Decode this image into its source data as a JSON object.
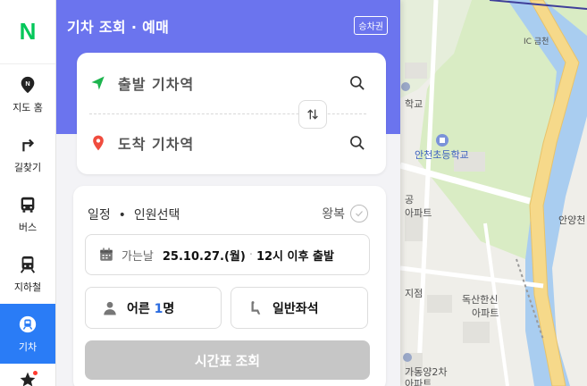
{
  "nav": {
    "logo": "N",
    "items": [
      {
        "label": "지도 홈",
        "icon": "map-pin-icon"
      },
      {
        "label": "길찾기",
        "icon": "directions-icon"
      },
      {
        "label": "버스",
        "icon": "bus-icon"
      },
      {
        "label": "지하철",
        "icon": "subway-icon"
      },
      {
        "label": "기차",
        "icon": "train-icon",
        "active": true
      }
    ]
  },
  "panel": {
    "title": "기차 조회 · 예매",
    "ticket_button": "승차권",
    "departure_placeholder": "출발 기차역",
    "arrival_placeholder": "도착 기차역",
    "schedule_header": "일정  •  인원선택",
    "roundtrip_label": "왕복",
    "date_label": "가는날",
    "date_value": "25.10.27.(월)",
    "date_separator": "·",
    "time_value": "12시 이후 출발",
    "passenger_prefix": "어른 ",
    "passenger_count": "1",
    "passenger_suffix": "명",
    "seat_label": "일반좌석",
    "submit_label": "시간표 조회"
  },
  "map": {
    "labels": [
      {
        "text": "IC 금천"
      },
      {
        "text": "학교"
      },
      {
        "text": "안천초등학교"
      },
      {
        "text": "공"
      },
      {
        "text": "아파트"
      },
      {
        "text": "안양천"
      },
      {
        "text": "독산한신"
      },
      {
        "text": "아파트"
      },
      {
        "text": "지점"
      },
      {
        "text": "가동양2차"
      },
      {
        "text": "아파트"
      }
    ]
  },
  "colors": {
    "header": "#6b74ee",
    "active_nav": "#2a7cf6",
    "logo_green": "#03c75a",
    "departure_green": "#1db44e",
    "arrival_red": "#f04c3e"
  }
}
